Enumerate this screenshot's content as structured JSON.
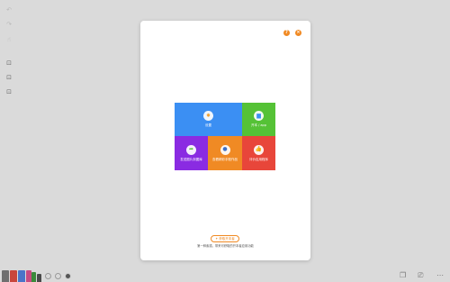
{
  "toolbar_left": {
    "icons": [
      "undo-icon",
      "redo-icon",
      "pointer-icon",
      "lock-icon",
      "lock-icon",
      "lock-icon"
    ]
  },
  "dialog": {
    "help_icon": "?",
    "close_icon": "×",
    "tiles": [
      {
        "label": "设置",
        "icon": "gear",
        "color": "#3b8ff3"
      },
      {
        "label": "开本 / app",
        "icon": "book",
        "color": "#55c236"
      },
      {
        "label": "发送图片到图库",
        "icon": "share",
        "color": "#8a2be2"
      },
      {
        "label": "查看精彩手账作品",
        "icon": "cat",
        "color": "#f08a24"
      },
      {
        "label": "评价应用程序",
        "icon": "thumb-up",
        "color": "#e8463a"
      }
    ],
    "invite_label": "获取开本者",
    "footer_note": "第一种素描，带来可获取的开本者应用功能"
  },
  "bottom_toolbar": {
    "pen_colors": [
      "#6f6f6f",
      "#c9463d",
      "#4a74c9",
      "#c84a82",
      "#3a8a3a",
      "#4a4a4a"
    ]
  }
}
